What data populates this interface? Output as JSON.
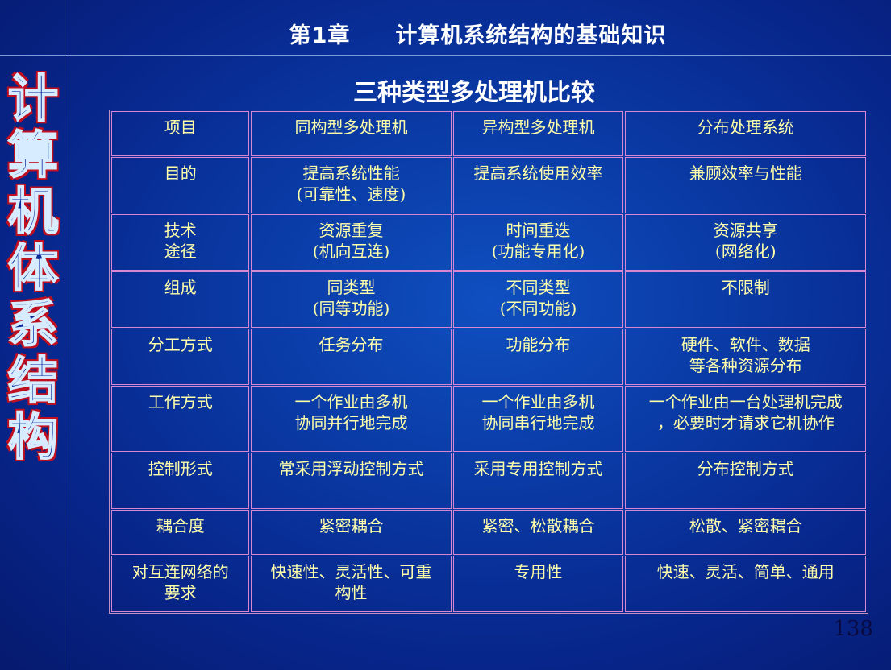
{
  "header": {
    "title": "第1章　　计算机系统结构的基础知识"
  },
  "side_title": [
    "计",
    "算",
    "机",
    "体",
    "系",
    "结",
    "构"
  ],
  "table_title": "三种类型多处理机比较",
  "table": {
    "headers": [
      "项目",
      "同构型多处理机",
      "异构型多处理机",
      "分布处理系统"
    ],
    "rows": [
      [
        "目的",
        "提高系统性能\n(可靠性、速度)",
        "提高系统使用效率",
        "兼顾效率与性能"
      ],
      [
        "技术\n途径",
        "资源重复\n(机向互连)",
        "时间重迭\n(功能专用化)",
        "资源共享\n(网络化)"
      ],
      [
        "组成",
        "同类型\n(同等功能)",
        "不同类型\n(不同功能)",
        "不限制"
      ],
      [
        "分工方式",
        "任务分布",
        "功能分布",
        "硬件、软件、数据\n等各种资源分布"
      ],
      [
        "工作方式",
        "一个作业由多机\n协同并行地完成",
        "一个作业由多机\n协同串行地完成",
        "一个作业由一台处理机完成\n，必要时才请求它机协作"
      ],
      [
        "控制形式",
        "常采用浮动控制方式",
        "采用专用控制方式",
        "分布控制方式"
      ],
      [
        "耦合度",
        "紧密耦合",
        "紧密、松散耦合",
        "松散、紧密耦合"
      ],
      [
        "对互连网络的\n要求",
        "快速性、灵活性、可重\n构性",
        "专用性",
        "快速、灵活、简单、通用"
      ]
    ]
  },
  "page_number": "138"
}
